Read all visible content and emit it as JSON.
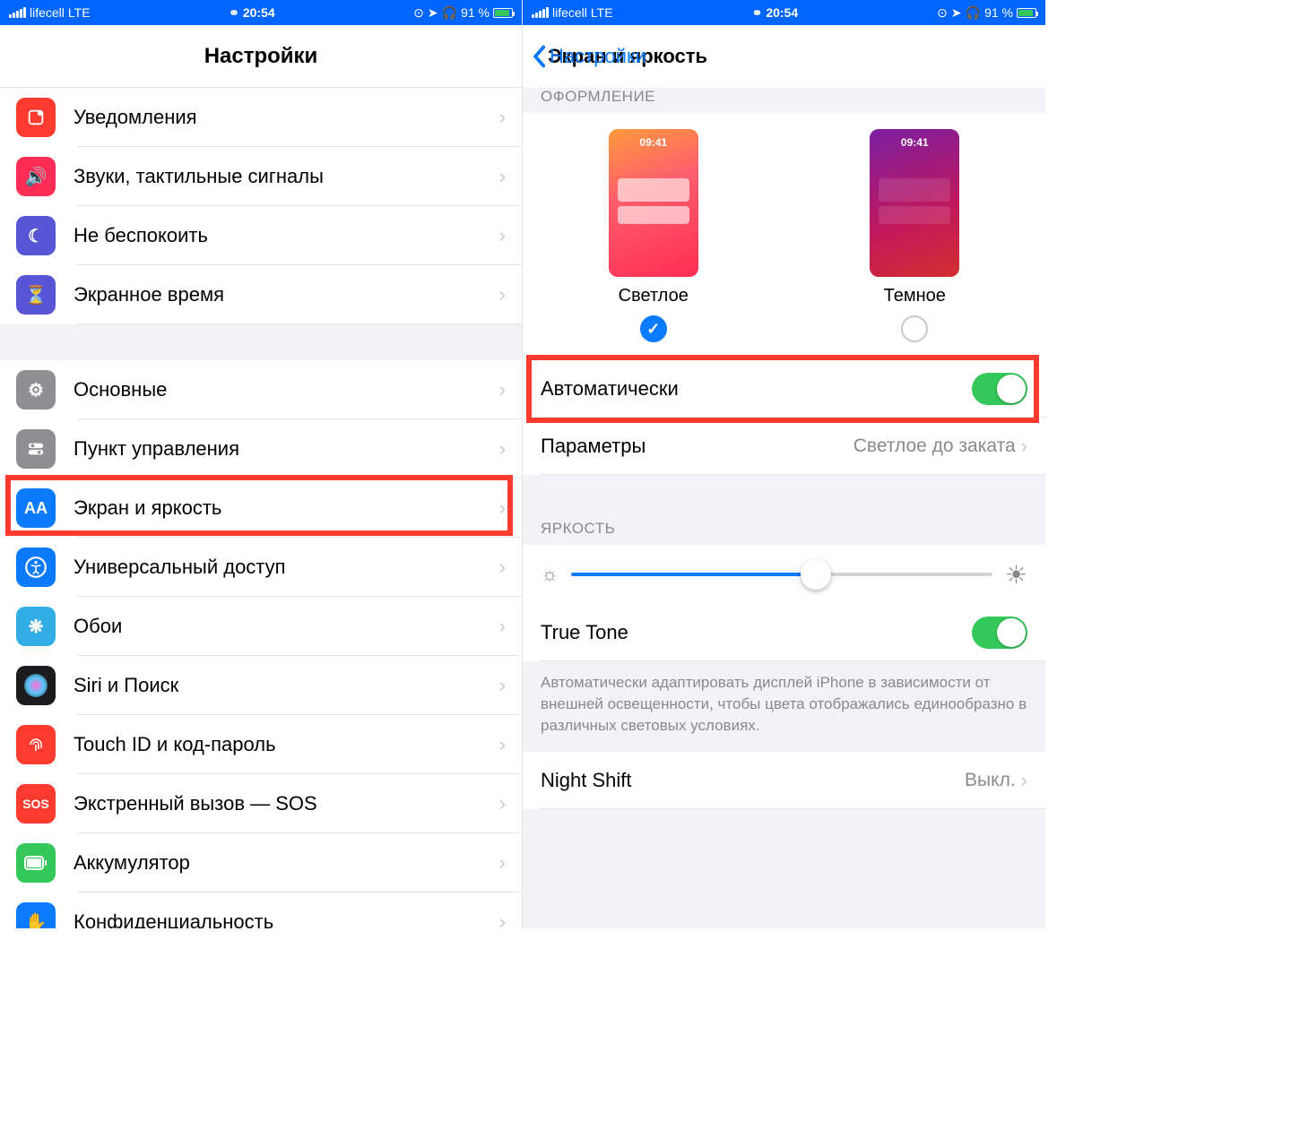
{
  "status": {
    "carrier": "lifecell",
    "net": "LTE",
    "time": "20:54",
    "battery": "91 %",
    "link_icon": "⚭",
    "lock_icon": "⊙",
    "loc_icon": "➤",
    "hp_icon": "🎧",
    "bolt": "⚡"
  },
  "left": {
    "title": "Настройки",
    "items": [
      {
        "label": "Уведомления"
      },
      {
        "label": "Звуки, тактильные сигналы"
      },
      {
        "label": "Не беспокоить"
      },
      {
        "label": "Экранное время"
      }
    ],
    "items2": [
      {
        "label": "Основные"
      },
      {
        "label": "Пункт управления"
      },
      {
        "label": "Экран и яркость"
      },
      {
        "label": "Универсальный доступ"
      },
      {
        "label": "Обои"
      },
      {
        "label": "Siri и Поиск"
      },
      {
        "label": "Touch ID и код-пароль"
      },
      {
        "label": "Экстренный вызов — SOS"
      },
      {
        "label": "Аккумулятор"
      },
      {
        "label": "Конфиденциальность"
      }
    ]
  },
  "right": {
    "back": "Настройки",
    "title": "Экран и яркость",
    "appearance_header": "ОФОРМЛЕНИЕ",
    "preview_time": "09:41",
    "light_label": "Светлое",
    "dark_label": "Темное",
    "auto_label": "Автоматически",
    "params_label": "Параметры",
    "params_value": "Светлое до заката",
    "brightness_header": "ЯРКОСТЬ",
    "truetone_label": "True Tone",
    "truetone_desc": "Автоматически адаптировать дисплей iPhone в зависимости от внешней освещенности, чтобы цвета отображались единообразно в различных световых условиях.",
    "nightshift_label": "Night Shift",
    "nightshift_value": "Выкл.",
    "brightness_pct": 58
  }
}
